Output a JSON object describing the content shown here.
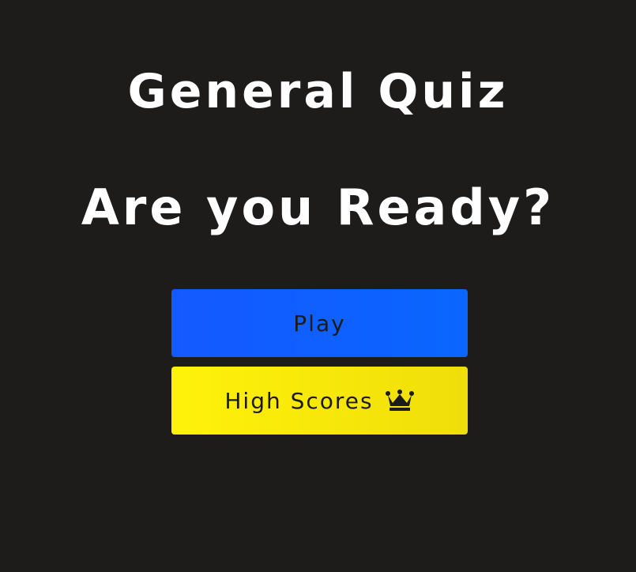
{
  "quiz": {
    "title": "General Quiz",
    "prompt": "Are you Ready?"
  },
  "buttons": {
    "play_label": "Play",
    "high_scores_label": "High Scores",
    "high_scores_icon": "crown-icon"
  },
  "colors": {
    "background": "#1e1b1b",
    "title_text": "#ffffff",
    "play_button": "#0a5fff",
    "high_scores_button": "#f7e80a",
    "button_text": "#1b1b1b"
  }
}
